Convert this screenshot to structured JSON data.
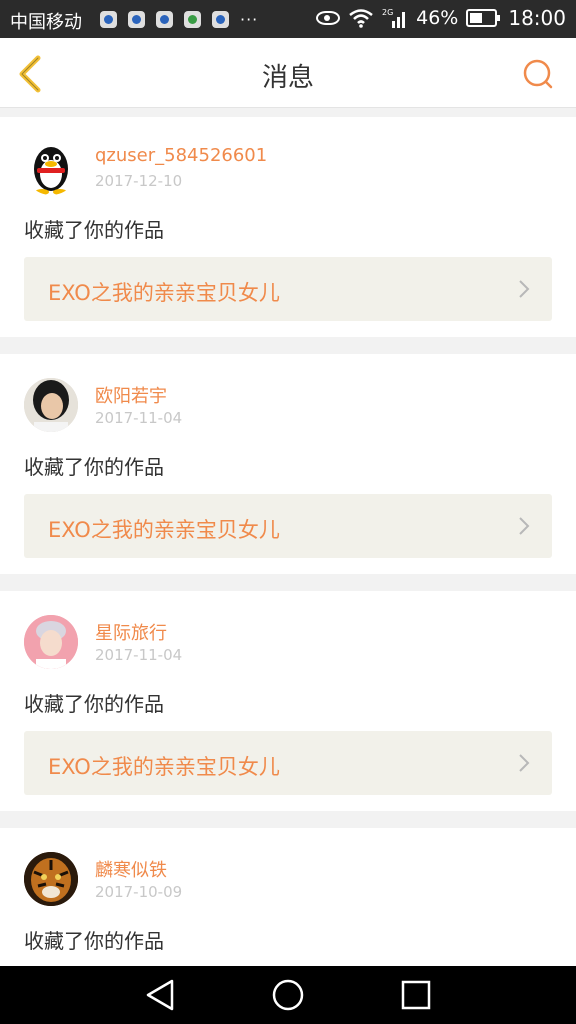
{
  "status_bar": {
    "carrier": "中国移动",
    "more": "···",
    "network": "2G",
    "battery": "46%",
    "time": "18:00"
  },
  "header": {
    "title": "消息"
  },
  "messages": [
    {
      "username": "qzuser_584526601",
      "date": "2017-12-10",
      "action": "收藏了你的作品",
      "work_title": "EXO之我的亲亲宝贝女儿",
      "avatar": "qq-penguin-avatar"
    },
    {
      "username": "欧阳若宇",
      "date": "2017-11-04",
      "action": "收藏了你的作品",
      "work_title": "EXO之我的亲亲宝贝女儿",
      "avatar": "girl-photo-avatar"
    },
    {
      "username": "星际旅行",
      "date": "2017-11-04",
      "action": "收藏了你的作品",
      "work_title": "EXO之我的亲亲宝贝女儿",
      "avatar": "boy-photo-avatar"
    },
    {
      "username": "麟寒似铁",
      "date": "2017-10-09",
      "action": "收藏了你的作品",
      "avatar": "tiger-avatar"
    }
  ],
  "colors": {
    "accent": "#f08a4b",
    "back_arrow": "#f2c037",
    "status_bar": "#2b2b2b",
    "card_link_bg": "#f2f1ea"
  }
}
